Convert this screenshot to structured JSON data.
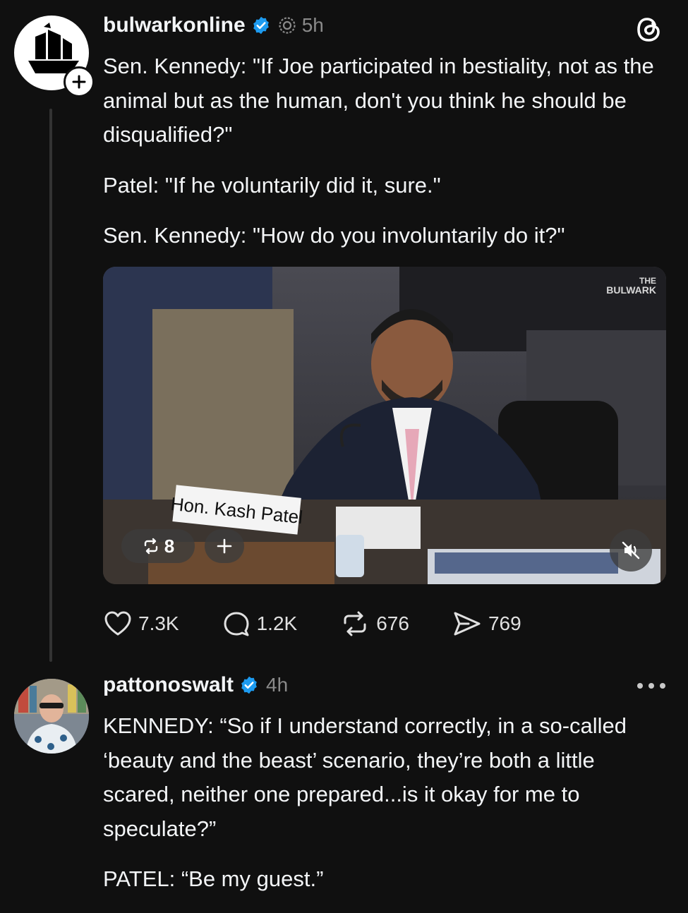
{
  "post1": {
    "username": "bulwarkonline",
    "time": "5h",
    "paragraphs": [
      "Sen. Kennedy: \"If Joe participated in bestiality, not as the animal but as the human, don't you think he should be disqualified?\"",
      "Patel: \"If he voluntarily did it, sure.\"",
      "Sen. Kennedy: \"How do you involuntarily do it?\""
    ],
    "video": {
      "nameplate": "Hon. Kash Patel",
      "watermark_top": "THE",
      "watermark_bottom": "BULWARK",
      "repost_count": "8"
    },
    "actions": {
      "likes": "7.3K",
      "replies": "1.2K",
      "reposts": "676",
      "shares": "769"
    }
  },
  "post2": {
    "username": "pattonoswalt",
    "time": "4h",
    "paragraphs": [
      "KENNEDY: “So if I understand correctly, in a so-called ‘beauty and the beast’ scenario, they’re both a little scared, neither one prepared...is it okay for me to speculate?”",
      "PATEL: “Be my guest.”"
    ]
  },
  "colors": {
    "background": "#101010",
    "verified": "#1d9bf0",
    "secondary": "#8a8a8a"
  }
}
